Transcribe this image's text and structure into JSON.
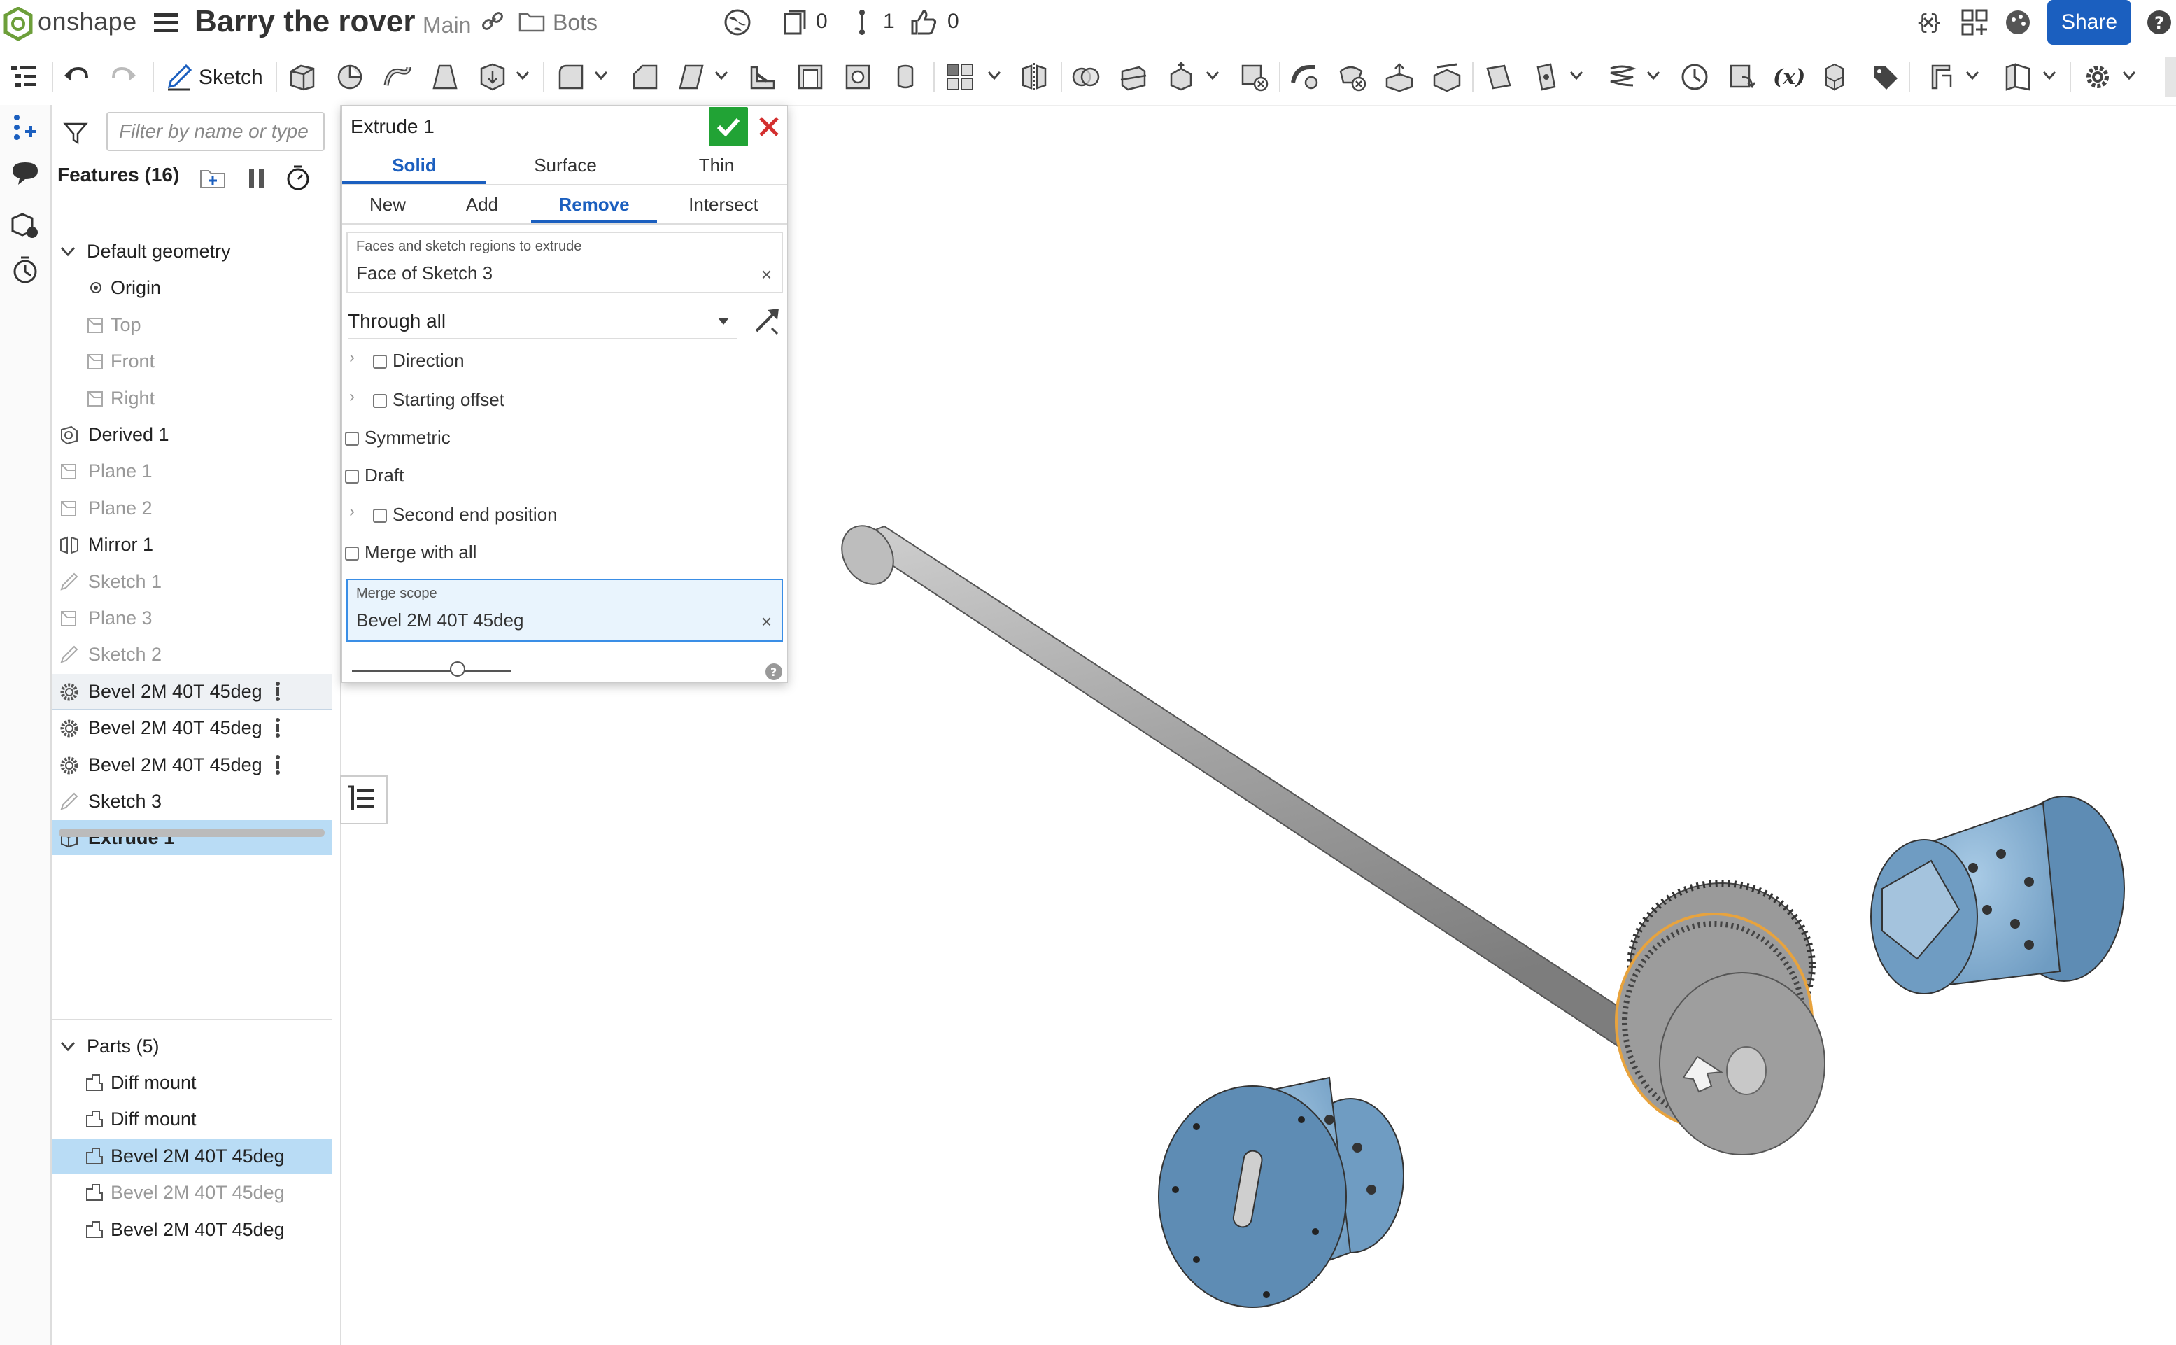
{
  "topbar": {
    "brand": "onshape",
    "doc_title": "Barry the rover",
    "branch": "Main",
    "folder": "Bots",
    "counts": {
      "versions": "0",
      "branches": "1",
      "likes": "0"
    },
    "share_label": "Share"
  },
  "toolbar": {
    "sketch_label": "Sketch"
  },
  "feature_panel": {
    "filter_placeholder": "Filter by name or type",
    "features_header": "Features (16)",
    "tree": [
      {
        "label": "Default geometry",
        "kind": "group"
      },
      {
        "label": "Origin",
        "kind": "origin"
      },
      {
        "label": "Top",
        "kind": "plane",
        "dim": true
      },
      {
        "label": "Front",
        "kind": "plane",
        "dim": true
      },
      {
        "label": "Right",
        "kind": "plane",
        "dim": true
      },
      {
        "label": "Derived 1",
        "kind": "derived"
      },
      {
        "label": "Plane 1",
        "kind": "plane",
        "dim": true
      },
      {
        "label": "Plane 2",
        "kind": "plane",
        "dim": true
      },
      {
        "label": "Mirror 1",
        "kind": "mirror"
      },
      {
        "label": "Sketch 1",
        "kind": "sketch",
        "dim": true
      },
      {
        "label": "Plane 3",
        "kind": "plane",
        "dim": true
      },
      {
        "label": "Sketch 2",
        "kind": "sketch",
        "dim": true
      },
      {
        "label": "Bevel 2M 40T 45deg",
        "kind": "gear"
      },
      {
        "label": "Bevel 2M 40T 45deg",
        "kind": "gear"
      },
      {
        "label": "Bevel 2M 40T 45deg",
        "kind": "gear"
      },
      {
        "label": "Sketch 3",
        "kind": "sketch"
      },
      {
        "label": "Extrude 1",
        "kind": "extrude",
        "selected": true
      }
    ],
    "parts_header": "Parts (5)",
    "parts": [
      {
        "label": "Diff mount"
      },
      {
        "label": "Diff mount"
      },
      {
        "label": "Bevel 2M 40T 45deg",
        "selected": true
      },
      {
        "label": "Bevel 2M 40T 45deg",
        "dim": true
      },
      {
        "label": "Bevel 2M 40T 45deg"
      }
    ]
  },
  "dialog": {
    "title": "Extrude 1",
    "tabs": [
      "Solid",
      "Surface",
      "Thin"
    ],
    "active_tab": "Solid",
    "ops": [
      "New",
      "Add",
      "Remove",
      "Intersect"
    ],
    "active_op": "Remove",
    "faces_caption": "Faces and sketch regions to extrude",
    "faces_value": "Face of Sketch 3",
    "end_type": "Through all",
    "options": {
      "direction": "Direction",
      "starting_offset": "Starting offset",
      "symmetric": "Symmetric",
      "draft": "Draft",
      "second_end": "Second end position",
      "merge_all": "Merge with all"
    },
    "merge_caption": "Merge scope",
    "merge_value": "Bevel 2M 40T 45deg",
    "x_glyph": "×"
  },
  "colors": {
    "accent": "#1b5fbf",
    "ok": "#21a335",
    "cancel": "#d32f2f",
    "selection": "#b9dcf5",
    "part_blue": "#8fb6d6",
    "shaft_gray": "#a6a6a6",
    "highlight": "#e8a33d"
  }
}
